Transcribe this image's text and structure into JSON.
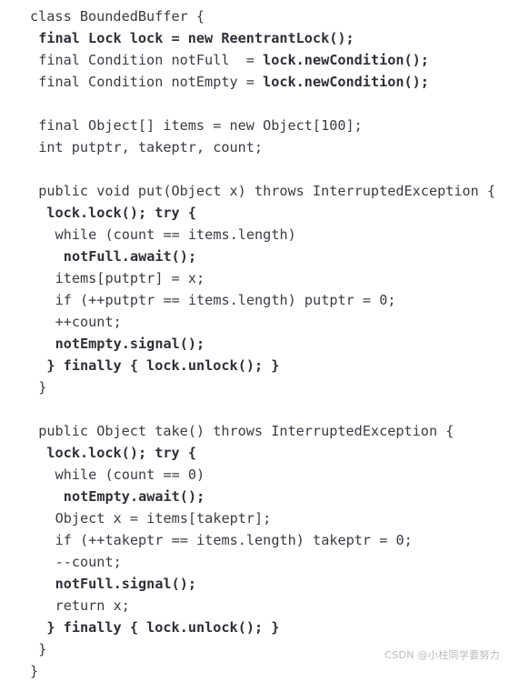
{
  "document": {
    "kind": "code-figure",
    "language": "java",
    "background_color": "#ffffff",
    "text_color": "#3b3b44",
    "bold_text_color": "#2f2f38",
    "font_size_px": 15.2,
    "line_height_px": 24,
    "title": "class BoundedBuffer"
  },
  "watermark": {
    "text": "CSDN @小柱同学要努力",
    "color": "#b9b9bf"
  },
  "code": {
    "lines": [
      {
        "indent": 0,
        "blank": false,
        "segments": [
          {
            "t": "class BoundedBuffer {",
            "bold": false
          }
        ]
      },
      {
        "indent": 1,
        "blank": false,
        "segments": [
          {
            "t": "final Lock lock = new ReentrantLock();",
            "bold": true
          }
        ]
      },
      {
        "indent": 1,
        "blank": false,
        "segments": [
          {
            "t": "final Condition notFull  = ",
            "bold": false
          },
          {
            "t": "lock.newCondition();",
            "bold": true
          }
        ]
      },
      {
        "indent": 1,
        "blank": false,
        "segments": [
          {
            "t": "final Condition notEmpty = ",
            "bold": false
          },
          {
            "t": "lock.newCondition();",
            "bold": true
          }
        ]
      },
      {
        "indent": 0,
        "blank": true,
        "segments": []
      },
      {
        "indent": 1,
        "blank": false,
        "segments": [
          {
            "t": "final Object[] items = new Object[100];",
            "bold": false
          }
        ]
      },
      {
        "indent": 1,
        "blank": false,
        "segments": [
          {
            "t": "int putptr, takeptr, count;",
            "bold": false
          }
        ]
      },
      {
        "indent": 0,
        "blank": true,
        "segments": []
      },
      {
        "indent": 1,
        "blank": false,
        "segments": [
          {
            "t": "public void put(Object x) throws InterruptedException {",
            "bold": false
          }
        ]
      },
      {
        "indent": 2,
        "blank": false,
        "segments": [
          {
            "t": "lock.lock(); try {",
            "bold": true
          }
        ]
      },
      {
        "indent": 3,
        "blank": false,
        "segments": [
          {
            "t": "while (count == items.length)",
            "bold": false
          }
        ]
      },
      {
        "indent": 4,
        "blank": false,
        "segments": [
          {
            "t": "notFull.await();",
            "bold": true
          }
        ]
      },
      {
        "indent": 3,
        "blank": false,
        "segments": [
          {
            "t": "items[putptr] = x;",
            "bold": false
          }
        ]
      },
      {
        "indent": 3,
        "blank": false,
        "segments": [
          {
            "t": "if (++putptr == items.length) putptr = 0;",
            "bold": false
          }
        ]
      },
      {
        "indent": 3,
        "blank": false,
        "segments": [
          {
            "t": "++count;",
            "bold": false
          }
        ]
      },
      {
        "indent": 3,
        "blank": false,
        "segments": [
          {
            "t": "notEmpty.signal();",
            "bold": true
          }
        ]
      },
      {
        "indent": 2,
        "blank": false,
        "segments": [
          {
            "t": "} finally { lock.unlock(); }",
            "bold": true
          }
        ]
      },
      {
        "indent": 1,
        "blank": false,
        "segments": [
          {
            "t": "}",
            "bold": false
          }
        ]
      },
      {
        "indent": 0,
        "blank": true,
        "segments": []
      },
      {
        "indent": 1,
        "blank": false,
        "segments": [
          {
            "t": "public Object take() throws InterruptedException {",
            "bold": false
          }
        ]
      },
      {
        "indent": 2,
        "blank": false,
        "segments": [
          {
            "t": "lock.lock(); try {",
            "bold": true
          }
        ]
      },
      {
        "indent": 3,
        "blank": false,
        "segments": [
          {
            "t": "while (count == 0)",
            "bold": false
          }
        ]
      },
      {
        "indent": 4,
        "blank": false,
        "segments": [
          {
            "t": "notEmpty.await();",
            "bold": true
          }
        ]
      },
      {
        "indent": 3,
        "blank": false,
        "segments": [
          {
            "t": "Object x = items[takeptr];",
            "bold": false
          }
        ]
      },
      {
        "indent": 3,
        "blank": false,
        "segments": [
          {
            "t": "if (++takeptr == items.length) takeptr = 0;",
            "bold": false
          }
        ]
      },
      {
        "indent": 3,
        "blank": false,
        "segments": [
          {
            "t": "--count;",
            "bold": false
          }
        ]
      },
      {
        "indent": 3,
        "blank": false,
        "segments": [
          {
            "t": "notFull.signal();",
            "bold": true
          }
        ]
      },
      {
        "indent": 3,
        "blank": false,
        "segments": [
          {
            "t": "return x;",
            "bold": false
          }
        ]
      },
      {
        "indent": 2,
        "blank": false,
        "segments": [
          {
            "t": "} finally { lock.unlock(); }",
            "bold": true
          }
        ]
      },
      {
        "indent": 1,
        "blank": false,
        "segments": [
          {
            "t": "}",
            "bold": false
          }
        ]
      },
      {
        "indent": 0,
        "blank": false,
        "segments": [
          {
            "t": "}",
            "bold": false
          }
        ]
      }
    ]
  }
}
